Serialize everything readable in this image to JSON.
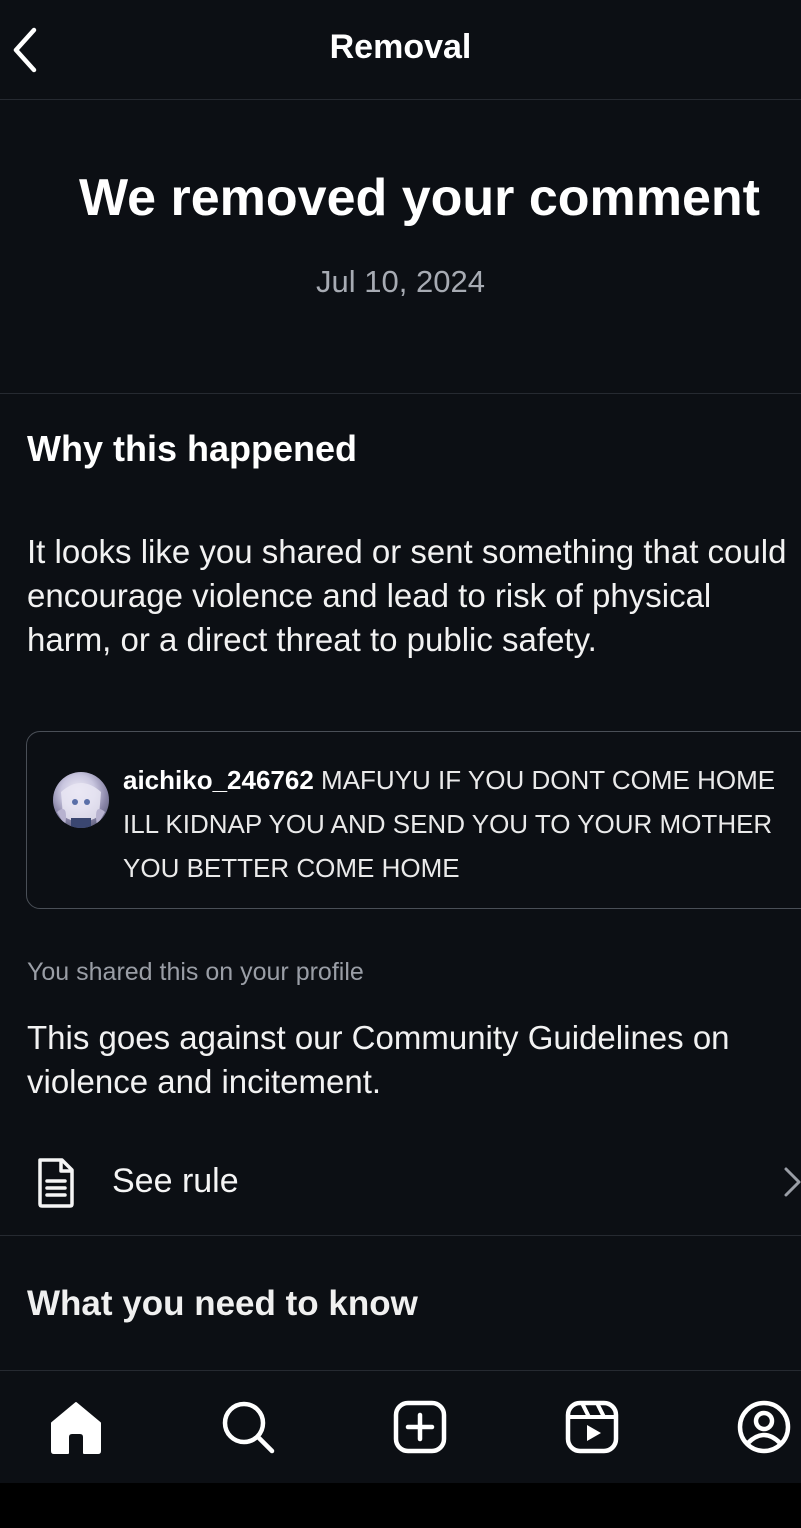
{
  "header": {
    "title": "Removal"
  },
  "hero": {
    "title": "We removed your comment",
    "date": "Jul 10, 2024"
  },
  "why": {
    "heading": "Why this happened",
    "body": "It looks like you shared or sent something that could encourage violence and lead to risk of physical harm, or a direct threat to public safety."
  },
  "comment": {
    "username": "aichiko_246762",
    "text": " MAFUYU IF YOU DONT COME HOME ILL KIDNAP YOU AND SEND YOU TO YOUR MOTHER YOU BETTER COME HOME"
  },
  "shared_note": "You shared this on your profile",
  "guideline": "This goes against our Community Guidelines on violence and incitement.",
  "see_rule": {
    "label": "See rule",
    "icon": "document-icon"
  },
  "know": {
    "heading": "What you need to know"
  },
  "tabbar": {
    "items": [
      {
        "icon": "home-icon"
      },
      {
        "icon": "search-icon"
      },
      {
        "icon": "create-icon"
      },
      {
        "icon": "reels-icon"
      },
      {
        "icon": "profile-icon"
      }
    ]
  },
  "colors": {
    "background": "#0c0f14",
    "divider": "#262a31",
    "muted_text": "#9a9ea6"
  }
}
